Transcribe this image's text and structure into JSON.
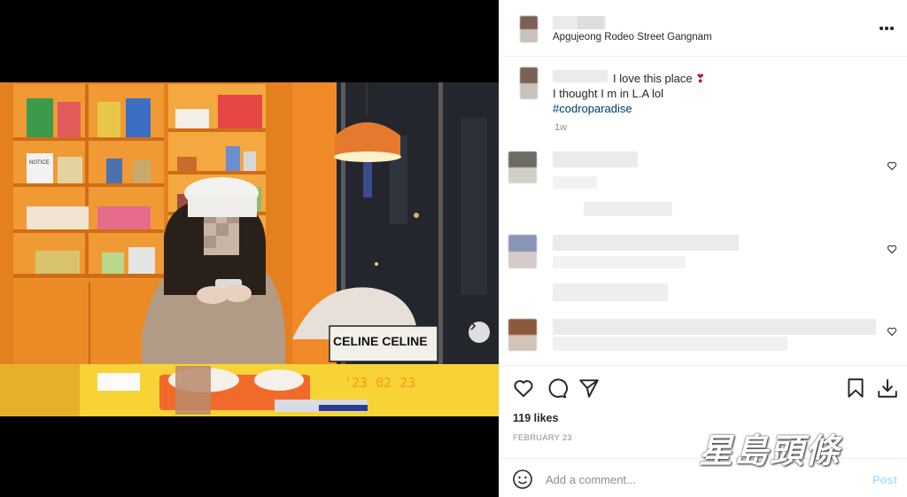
{
  "post": {
    "location": "Apgujeong Rodeo Street Gangnam",
    "caption_line1": "I love this place",
    "caption_heart": "❣",
    "caption_line2": "I thought I m in L.A lol",
    "hashtag": "#codroparadise",
    "time_ago": "1w",
    "likes": "119 likes",
    "date": "FEBRUARY 23",
    "comment_placeholder": "Add a comment...",
    "post_label": "Post"
  },
  "photo": {
    "stamp": "'23 02 23",
    "sign_text": "CELINE CELINE",
    "box_text": "NOTICE"
  },
  "icons": [
    "more-icon",
    "heart-icon",
    "comment-icon",
    "share-icon",
    "bookmark-icon",
    "download-icon",
    "emoji-icon",
    "chevron-right-icon"
  ],
  "watermark": "星島頭條",
  "colors": {
    "link": "#00376b",
    "post_disabled": "#b2dffc",
    "muted": "#8e8e8e"
  }
}
